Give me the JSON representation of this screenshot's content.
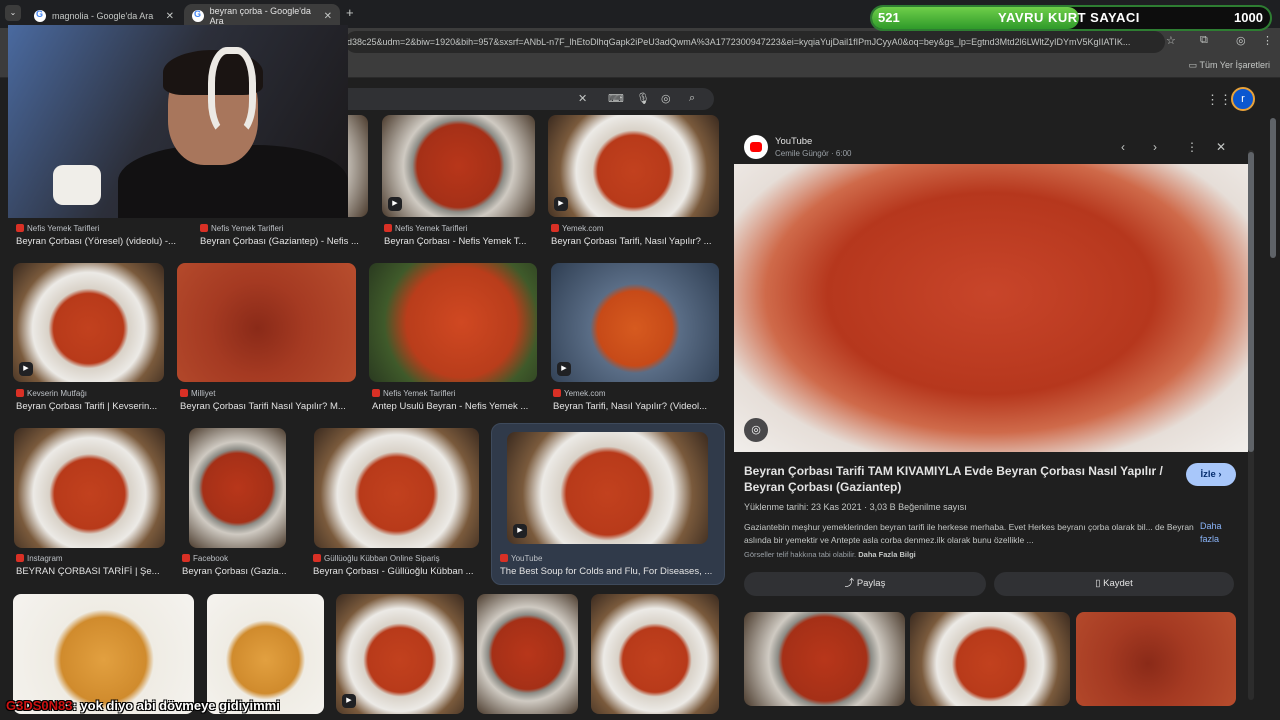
{
  "browser": {
    "tabs": [
      {
        "title": "magnolia - Google'da Ara"
      },
      {
        "title": "beyran çorba - Google'da Ara"
      }
    ],
    "url": "d38c25&udm=2&biw=1920&bih=957&sxsrf=ANbL-n7F_lhEtoDlhqGapk2iPeU3adQwmA%3A1772300947223&ei=kyqiaYujDail1fIPmJCyyA0&oq=bey&gs_lp=Egtnd3Mtd2l6LWltZyIDYmV5KgIIATIK...",
    "bookmarks_all": "Tüm Yer İşaretleri"
  },
  "results": [
    {
      "source": "Nefis Yemek Tarifleri",
      "title": "Beyran Çorbası (Yöresel) (videolu) -..."
    },
    {
      "source": "Nefis Yemek Tarifleri",
      "title": "Beyran Çorbası (Gaziantep) - Nefis ..."
    },
    {
      "source": "Nefis Yemek Tarifleri",
      "title": "Beyran Çorbası - Nefis Yemek T..."
    },
    {
      "source": "Yemek.com",
      "title": "Beyran Çorbası Tarifi, Nasıl Yapılır? ..."
    },
    {
      "source": "Kevserin Mutfağı",
      "title": "Beyran Çorbası Tarifi | Kevserin..."
    },
    {
      "source": "Milliyet",
      "title": "Beyran Çorbası Tarifi Nasıl Yapılır? M..."
    },
    {
      "source": "Nefis Yemek Tarifleri",
      "title": "Antep Usulü Beyran - Nefis Yemek ..."
    },
    {
      "source": "Yemek.com",
      "title": "Beyran Tarifi, Nasıl Yapılır? (Videol..."
    },
    {
      "source": "Instagram",
      "title": "BEYRAN ÇORBASI TARİFİ | Şe..."
    },
    {
      "source": "Facebook",
      "title": "Beyran Çorbası (Gazia..."
    },
    {
      "source": "Güllüoğlu Kübban Online Sipariş",
      "title": "Beyran Çorbası - Güllüoğlu Kübban ..."
    },
    {
      "source": "YouTube",
      "title": "The Best Soup for Colds and Flu, For Diseases, ..."
    }
  ],
  "panel": {
    "source": "YouTube",
    "subtitle": "Cemile Güngör · 6:00",
    "title": "Beyran Çorbası Tarifi TAM KIVAMIYLA Evde Beyran Çorbası Nasıl Yapılır / Beyran Çorbası (Gaziantep)",
    "follow_label": "İzle ›",
    "date": "Yüklenme tarihi: 23 Kas 2021",
    "likes": "3,03 B Beğenilme sayısı",
    "description": "Gaziantebin meşhur yemeklerinden beyran tarifi ile herkese merhaba. Evet Herkes beyranı çorba olarak bil... de Beyran aslında bir yemektir ve Antepte asla corba denmez.ilk olarak bunu özellikle ...",
    "more_label": "Daha fazla",
    "copyright": "Görseller telif hakkına tabi olabilir.",
    "more_info": "Daha Fazla Bilgi",
    "share_label": "Paylaş",
    "save_label": "Kaydet"
  },
  "overlay": {
    "counter_left": "521",
    "counter_title": "YAVRU KURT SAYACI",
    "counter_right": "1000",
    "counter_progress": 0.521,
    "chat_user": "G3DS0N83",
    "chat_message": ": yok diyo abi dövmeye gidiyimmi"
  }
}
